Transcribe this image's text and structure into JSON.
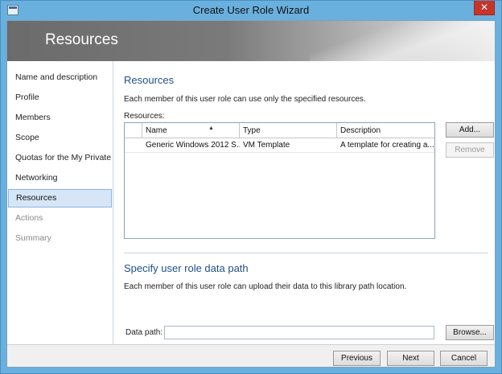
{
  "window": {
    "title": "Create User Role Wizard",
    "close_glyph": "✕"
  },
  "banner": {
    "title": "Resources"
  },
  "nav": {
    "items": [
      {
        "label": "Name and description"
      },
      {
        "label": "Profile"
      },
      {
        "label": "Members"
      },
      {
        "label": "Scope"
      },
      {
        "label": "Quotas for the My Private..."
      },
      {
        "label": "Networking"
      },
      {
        "label": "Resources"
      },
      {
        "label": "Actions"
      },
      {
        "label": "Summary"
      }
    ],
    "selected": "Resources"
  },
  "resources_section": {
    "title": "Resources",
    "description": "Each member of this user role can use only the specified resources.",
    "list_label": "Resources:",
    "columns": [
      "Name",
      "Type",
      "Description"
    ],
    "rows": [
      {
        "name": "Generic Windows 2012 S...",
        "type": "VM Template",
        "description": "A template for creating a..."
      }
    ],
    "add_label": "Add...",
    "remove_label": "Remove"
  },
  "datapath_section": {
    "title": "Specify user role data path",
    "description": "Each member of this user role can upload their data to this library path location.",
    "field_label": "Data path:",
    "field_value": "",
    "browse_label": "Browse..."
  },
  "footer": {
    "previous_label": "Previous",
    "next_label": "Next",
    "cancel_label": "Cancel"
  }
}
